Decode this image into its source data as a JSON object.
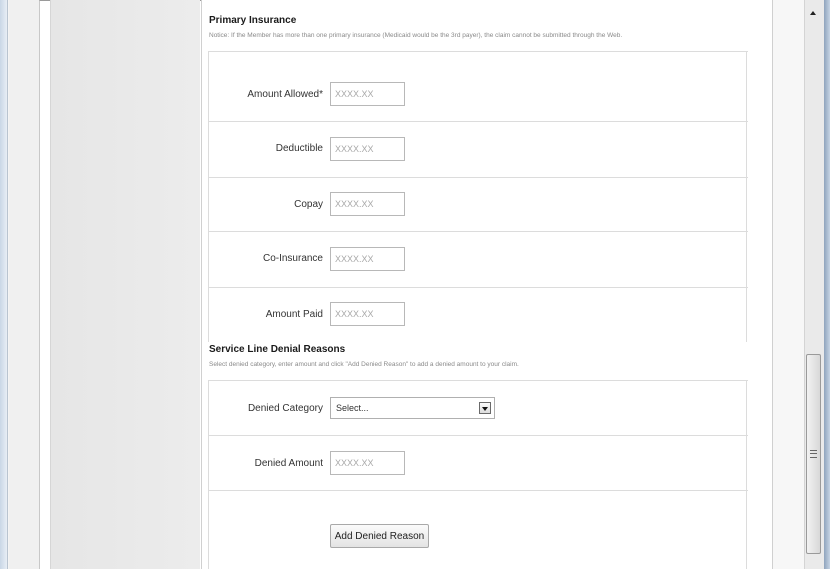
{
  "primary_insurance": {
    "title": "Primary Insurance",
    "notice": "Notice: If the Member has more than one primary insurance (Medicaid would be the 3rd payer), the claim cannot be submitted through the Web.",
    "fields": [
      {
        "label": "Amount Allowed*",
        "placeholder": "XXXX.XX"
      },
      {
        "label": "Deductible",
        "placeholder": "XXXX.XX"
      },
      {
        "label": "Copay",
        "placeholder": "XXXX.XX"
      },
      {
        "label": "Co-Insurance",
        "placeholder": "XXXX.XX"
      },
      {
        "label": "Amount Paid",
        "placeholder": "XXXX.XX"
      }
    ]
  },
  "denial_reasons": {
    "title": "Service Line Denial Reasons",
    "note": "Select denied category, enter amount and click \"Add Denied Reason\" to add a denied amount to your claim.",
    "category_label": "Denied Category",
    "category_value": "Select...",
    "amount_label": "Denied Amount",
    "amount_placeholder": "XXXX.XX",
    "add_button": "Add Denied Reason"
  }
}
